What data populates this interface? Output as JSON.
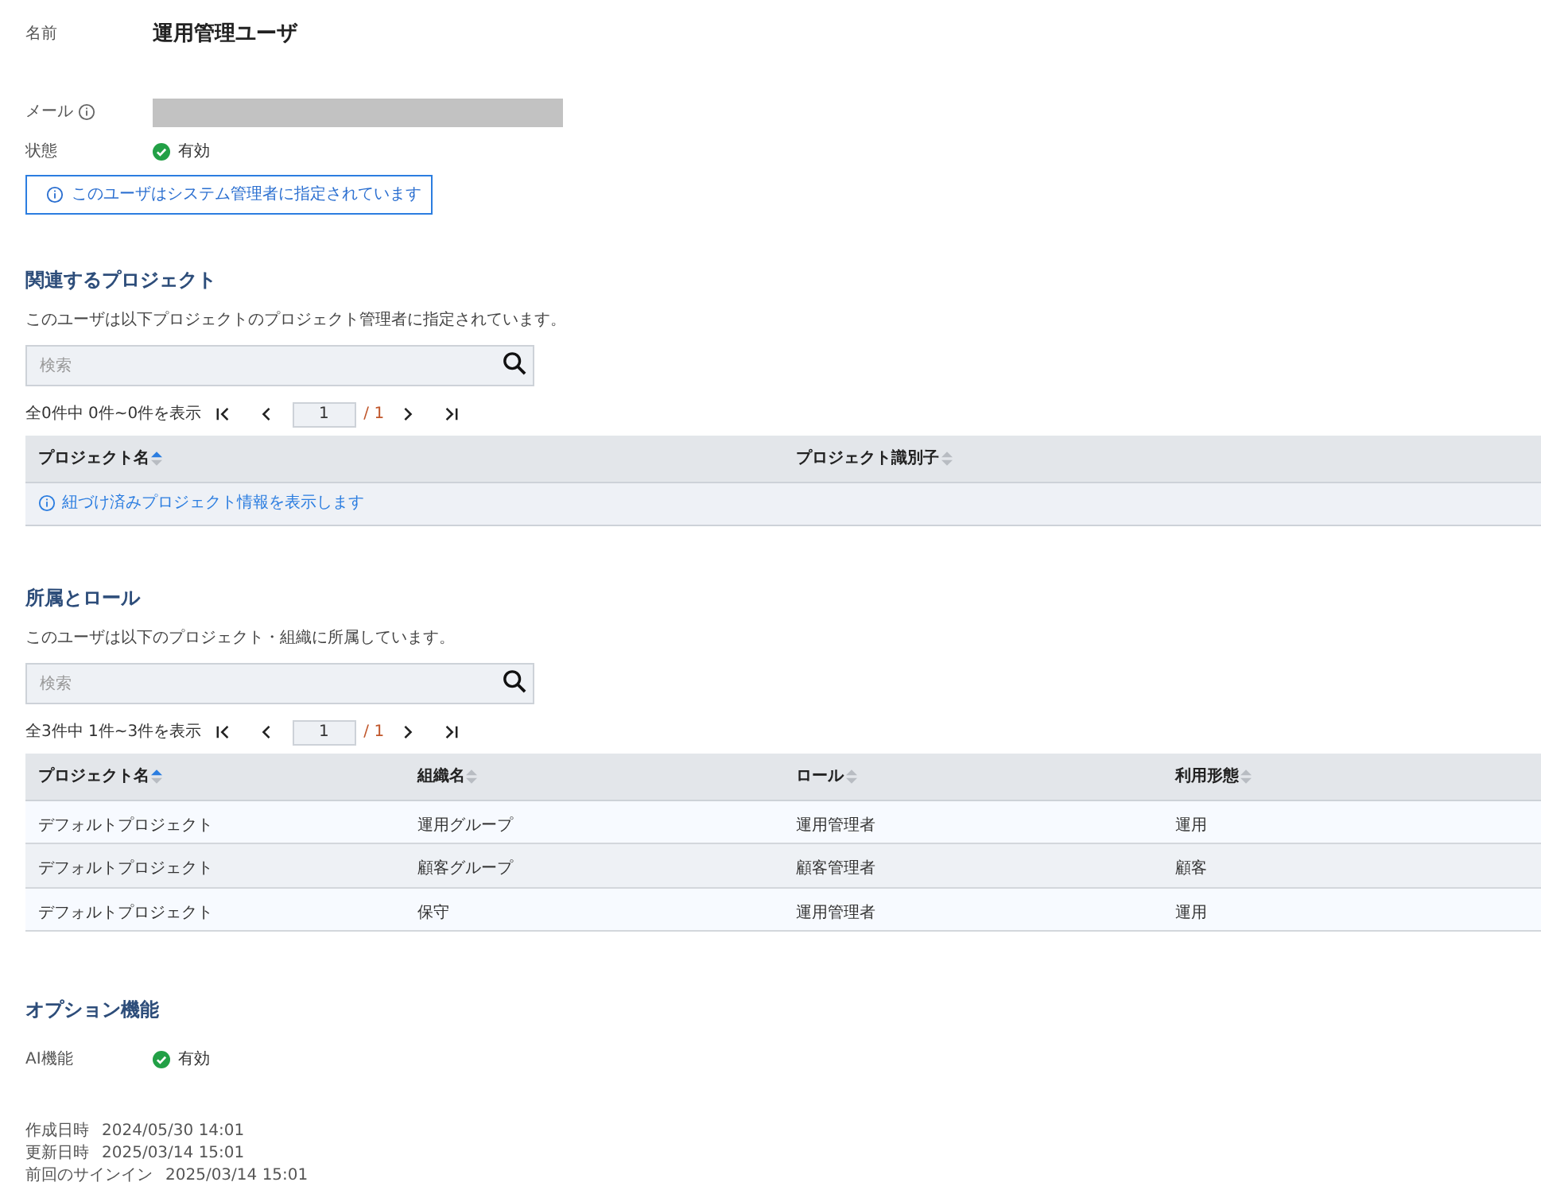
{
  "profile": {
    "name_label": "名前",
    "name": "運用管理ユーザ",
    "email_label": "メール",
    "status_label": "状態",
    "status": "有効"
  },
  "notice": "このユーザはシステム管理者に指定されています",
  "sections": [
    {
      "title": "関連するプロジェクト",
      "description": "このユーザは以下プロジェクトのプロジェクト管理者に指定されています。",
      "search_placeholder": "検索",
      "pagination": {
        "summary": "全0件中 0件~0件を表示",
        "page": "1",
        "total": "/ 1"
      },
      "columns": [
        {
          "label": "プロジェクト名",
          "sorted": true
        },
        {
          "label": "プロジェクト識別子",
          "sorted": false
        }
      ],
      "empty_message": "紐づけ済みプロジェクト情報を表示します"
    },
    {
      "title": "所属とロール",
      "description": "このユーザは以下のプロジェクト・組織に所属しています。",
      "search_placeholder": "検索",
      "pagination": {
        "summary": "全3件中 1件~3件を表示",
        "page": "1",
        "total": "/ 1"
      },
      "columns": [
        {
          "label": "プロジェクト名",
          "sorted": true
        },
        {
          "label": "組織名",
          "sorted": false
        },
        {
          "label": "ロール",
          "sorted": false
        },
        {
          "label": "利用形態",
          "sorted": false
        }
      ],
      "rows": [
        [
          "デフォルトプロジェクト",
          "運用グループ",
          "運用管理者",
          "運用"
        ],
        [
          "デフォルトプロジェクト",
          "顧客グループ",
          "顧客管理者",
          "顧客"
        ],
        [
          "デフォルトプロジェクト",
          "保守",
          "運用管理者",
          "運用"
        ]
      ]
    }
  ],
  "options": {
    "title": "オプション機能",
    "items": [
      {
        "label": "AI機能",
        "value": "有効"
      }
    ]
  },
  "timestamps": [
    {
      "label": "作成日時",
      "value": "2024/05/30 14:01"
    },
    {
      "label": "更新日時",
      "value": "2025/03/14 15:01"
    },
    {
      "label": "前回のサインイン",
      "value": "2025/03/14 15:01"
    }
  ]
}
